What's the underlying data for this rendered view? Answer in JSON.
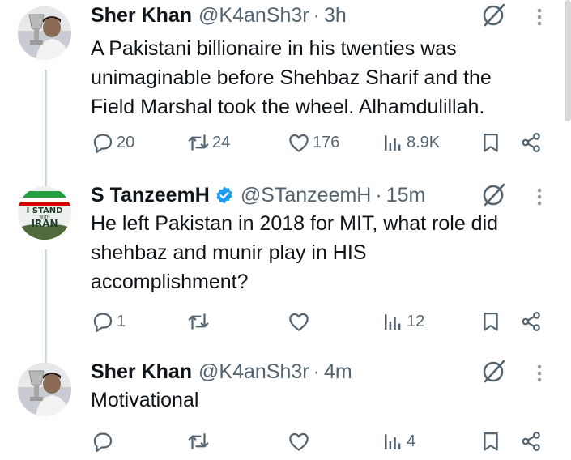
{
  "tweets": [
    {
      "name": "Sher Khan",
      "handle": "@K4anSh3r",
      "separator": "·",
      "time": "3h",
      "verified": false,
      "lines": [
        "A Pakistani billionaire in his twenties was",
        "unimaginable before Shehbaz Sharif and the",
        "Field Marshal took the wheel. Alhamdulillah."
      ],
      "replies": "20",
      "reposts": "24",
      "likes": "176",
      "views": "8.9K"
    },
    {
      "name": "S TanzeemH",
      "handle": "@STanzeemH",
      "separator": "·",
      "time": "15m",
      "verified": true,
      "avatar_text": {
        "line1": "I STAND",
        "line2": "WITH",
        "line3": "IRAN"
      },
      "lines": [
        "He left Pakistan in 2018 for MIT, what role did",
        "shehbaz and munir play in HIS",
        "accomplishment?"
      ],
      "replies": "1",
      "reposts": "",
      "likes": "",
      "views": "12"
    },
    {
      "name": "Sher Khan",
      "handle": "@K4anSh3r",
      "separator": "·",
      "time": "4m",
      "verified": false,
      "lines": [
        "Motivational"
      ],
      "replies": "",
      "reposts": "",
      "likes": "",
      "views": "4"
    }
  ],
  "colors": {
    "text": "#0f1419",
    "secondary": "#536471",
    "thread_line": "#cfd9de",
    "verified": "#1d9bf0"
  },
  "icons": [
    "reply-icon",
    "repost-icon",
    "like-icon",
    "views-icon",
    "bookmark-icon",
    "share-icon",
    "grok-icon",
    "more-icon",
    "verified-badge-icon"
  ]
}
